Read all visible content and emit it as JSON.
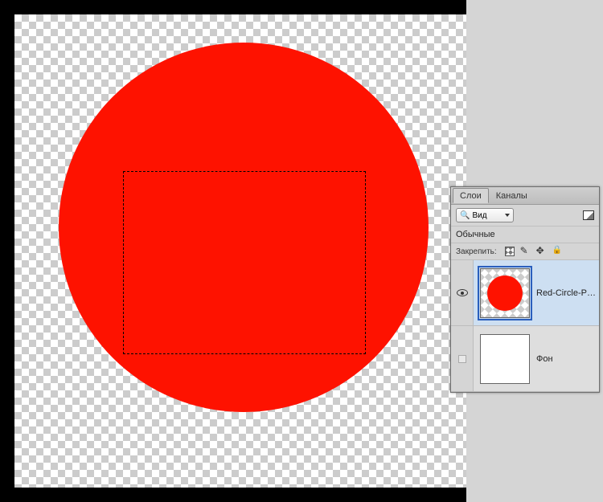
{
  "panel": {
    "tabs": {
      "layers": "Слои",
      "channels": "Каналы"
    },
    "search_label": "Вид",
    "blend_mode": "Обычные",
    "lock_label": "Закрепить:"
  },
  "layers": [
    {
      "name": "Red-Circle-PNG",
      "visible": true
    },
    {
      "name": "Фон",
      "visible": false
    }
  ]
}
